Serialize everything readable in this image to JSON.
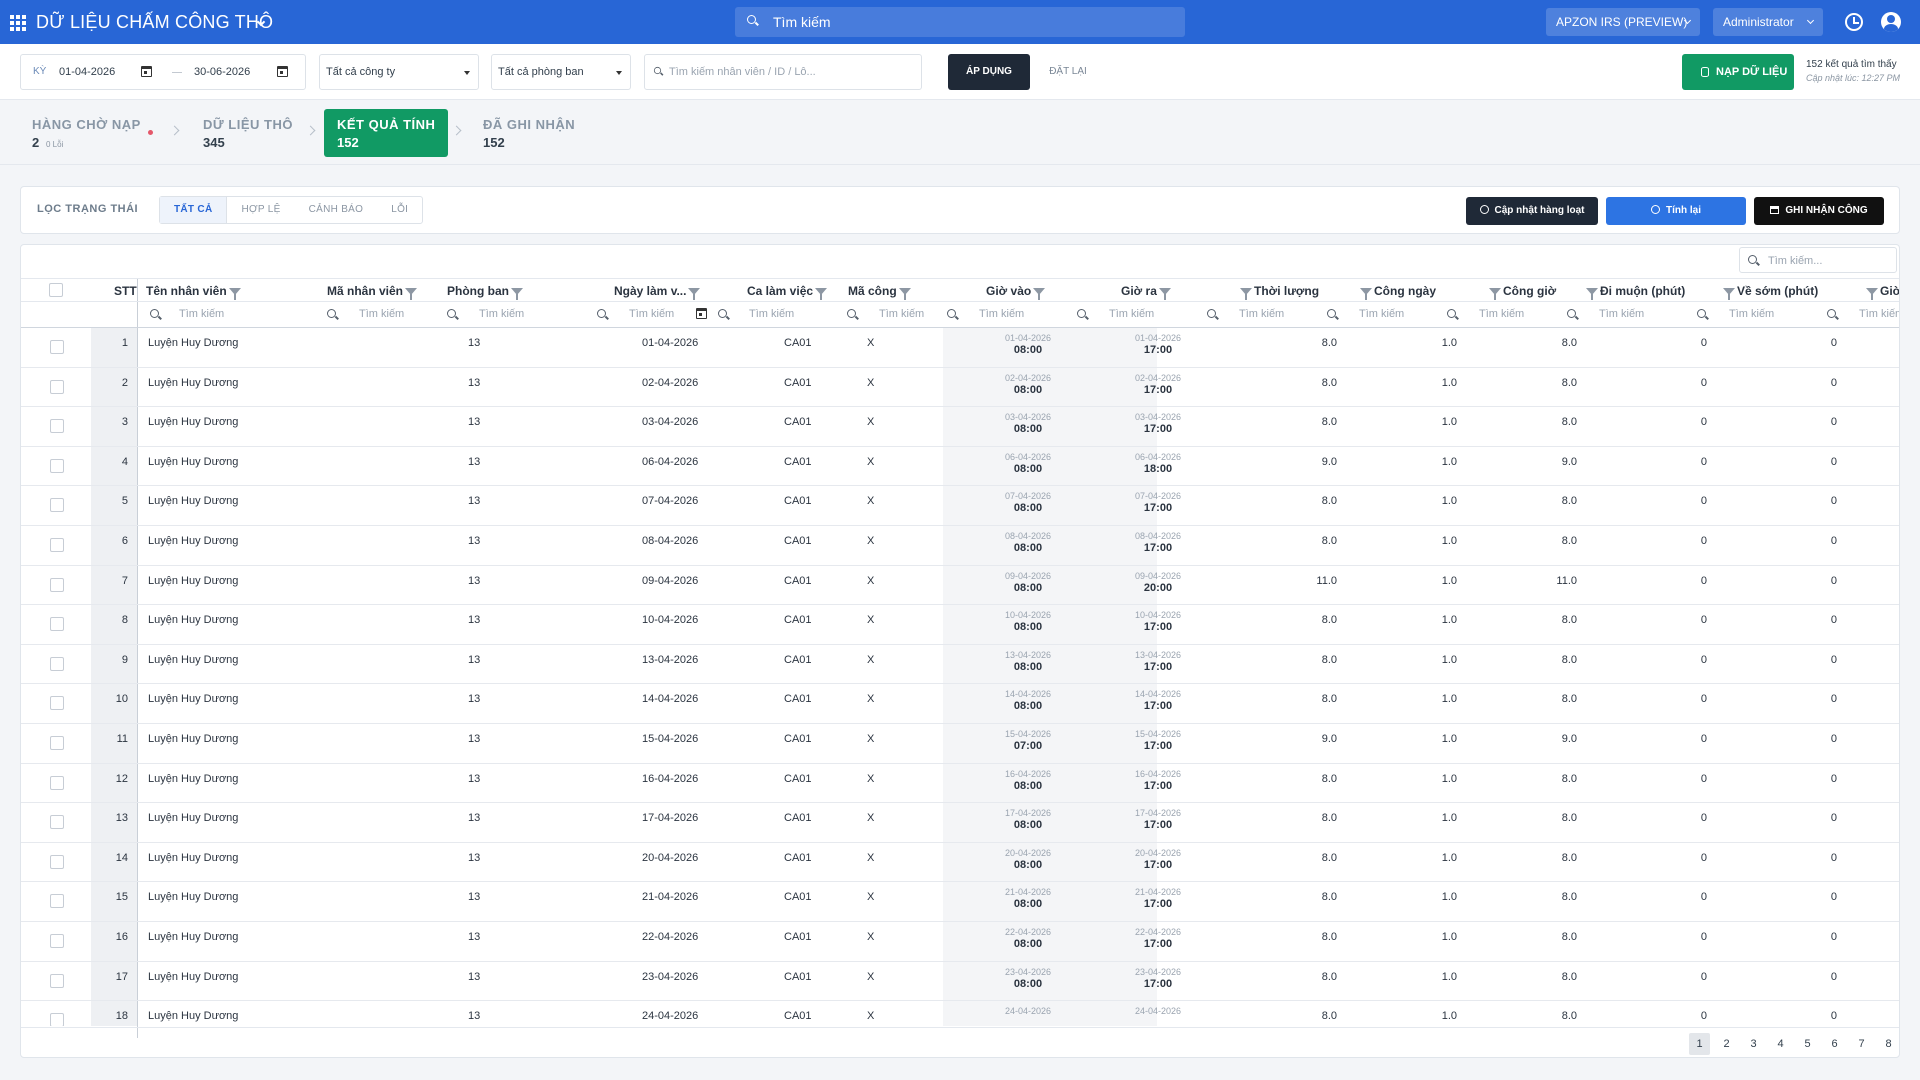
{
  "header": {
    "title": "DỮ LIỆU CHẤM CÔNG THÔ",
    "search_placeholder": "Tìm kiếm",
    "environment": "APZON IRS (PREVIEW)",
    "user": "Administrator"
  },
  "filters": {
    "period_label": "KỲ",
    "date_from": "01-04-2026",
    "date_to": "30-06-2026",
    "company": "Tất cả công ty",
    "department": "Tất cả phòng ban",
    "employee_search_placeholder": "Tìm kiếm nhân viên / ID / Lô...",
    "apply_label": "ÁP DỤNG",
    "reset_label": "ĐẶT LẠI",
    "load_label": "NẠP DỮ LIỆU",
    "result_count": "152 kết quả tìm thấy",
    "updated": "Cập nhật lúc: 12:27 PM"
  },
  "steps": [
    {
      "title": "HÀNG CHỜ NẠP",
      "count": "2",
      "sub": "0 Lỗi"
    },
    {
      "title": "DỮ LIỆU THÔ",
      "count": "345"
    },
    {
      "title": "KẾT QUẢ TÍNH",
      "count": "152"
    },
    {
      "title": "ĐÃ GHI NHẬN",
      "count": "152"
    }
  ],
  "status_filter": {
    "label": "LỌC TRẠNG THÁI",
    "options": [
      "TẤT CẢ",
      "HỢP LỆ",
      "CẢNH BÁO",
      "LỖI"
    ]
  },
  "actions": {
    "bulk_update": "Cập nhật hàng loạt",
    "recalc": "Tính lại",
    "record": "GHI NHẬN CÔNG"
  },
  "table": {
    "search_placeholder": "Tìm kiếm...",
    "filter_placeholder": "Tìm kiếm",
    "columns": [
      "STT",
      "Tên nhân viên",
      "Mã nhân viên",
      "Phòng ban",
      "Ngày làm v...",
      "Ca làm việc",
      "Mã công",
      "Giờ vào",
      "Giờ ra",
      "Thời lượng",
      "Công ngày",
      "Công giờ",
      "Đi muộn (phút)",
      "Về sớm (phút)",
      "Giờ"
    ],
    "rows": [
      {
        "stt": "1",
        "name": "Luyện Huy Dương",
        "dept": "13",
        "date": "01-04-2026",
        "shift": "CA01",
        "code": "X",
        "in_d": "01-04-2026",
        "in_t": "08:00",
        "out_d": "01-04-2026",
        "out_t": "17:00",
        "dur": "8.0",
        "day": "1.0",
        "hour": "8.0",
        "late": "0",
        "early": "0"
      },
      {
        "stt": "2",
        "name": "Luyện Huy Dương",
        "dept": "13",
        "date": "02-04-2026",
        "shift": "CA01",
        "code": "X",
        "in_d": "02-04-2026",
        "in_t": "08:00",
        "out_d": "02-04-2026",
        "out_t": "17:00",
        "dur": "8.0",
        "day": "1.0",
        "hour": "8.0",
        "late": "0",
        "early": "0"
      },
      {
        "stt": "3",
        "name": "Luyện Huy Dương",
        "dept": "13",
        "date": "03-04-2026",
        "shift": "CA01",
        "code": "X",
        "in_d": "03-04-2026",
        "in_t": "08:00",
        "out_d": "03-04-2026",
        "out_t": "17:00",
        "dur": "8.0",
        "day": "1.0",
        "hour": "8.0",
        "late": "0",
        "early": "0"
      },
      {
        "stt": "4",
        "name": "Luyện Huy Dương",
        "dept": "13",
        "date": "06-04-2026",
        "shift": "CA01",
        "code": "X",
        "in_d": "06-04-2026",
        "in_t": "08:00",
        "out_d": "06-04-2026",
        "out_t": "18:00",
        "dur": "9.0",
        "day": "1.0",
        "hour": "9.0",
        "late": "0",
        "early": "0"
      },
      {
        "stt": "5",
        "name": "Luyện Huy Dương",
        "dept": "13",
        "date": "07-04-2026",
        "shift": "CA01",
        "code": "X",
        "in_d": "07-04-2026",
        "in_t": "08:00",
        "out_d": "07-04-2026",
        "out_t": "17:00",
        "dur": "8.0",
        "day": "1.0",
        "hour": "8.0",
        "late": "0",
        "early": "0"
      },
      {
        "stt": "6",
        "name": "Luyện Huy Dương",
        "dept": "13",
        "date": "08-04-2026",
        "shift": "CA01",
        "code": "X",
        "in_d": "08-04-2026",
        "in_t": "08:00",
        "out_d": "08-04-2026",
        "out_t": "17:00",
        "dur": "8.0",
        "day": "1.0",
        "hour": "8.0",
        "late": "0",
        "early": "0"
      },
      {
        "stt": "7",
        "name": "Luyện Huy Dương",
        "dept": "13",
        "date": "09-04-2026",
        "shift": "CA01",
        "code": "X",
        "in_d": "09-04-2026",
        "in_t": "08:00",
        "out_d": "09-04-2026",
        "out_t": "20:00",
        "dur": "11.0",
        "day": "1.0",
        "hour": "11.0",
        "late": "0",
        "early": "0"
      },
      {
        "stt": "8",
        "name": "Luyện Huy Dương",
        "dept": "13",
        "date": "10-04-2026",
        "shift": "CA01",
        "code": "X",
        "in_d": "10-04-2026",
        "in_t": "08:00",
        "out_d": "10-04-2026",
        "out_t": "17:00",
        "dur": "8.0",
        "day": "1.0",
        "hour": "8.0",
        "late": "0",
        "early": "0"
      },
      {
        "stt": "9",
        "name": "Luyện Huy Dương",
        "dept": "13",
        "date": "13-04-2026",
        "shift": "CA01",
        "code": "X",
        "in_d": "13-04-2026",
        "in_t": "08:00",
        "out_d": "13-04-2026",
        "out_t": "17:00",
        "dur": "8.0",
        "day": "1.0",
        "hour": "8.0",
        "late": "0",
        "early": "0"
      },
      {
        "stt": "10",
        "name": "Luyện Huy Dương",
        "dept": "13",
        "date": "14-04-2026",
        "shift": "CA01",
        "code": "X",
        "in_d": "14-04-2026",
        "in_t": "08:00",
        "out_d": "14-04-2026",
        "out_t": "17:00",
        "dur": "8.0",
        "day": "1.0",
        "hour": "8.0",
        "late": "0",
        "early": "0"
      },
      {
        "stt": "11",
        "name": "Luyện Huy Dương",
        "dept": "13",
        "date": "15-04-2026",
        "shift": "CA01",
        "code": "X",
        "in_d": "15-04-2026",
        "in_t": "07:00",
        "out_d": "15-04-2026",
        "out_t": "17:00",
        "dur": "9.0",
        "day": "1.0",
        "hour": "9.0",
        "late": "0",
        "early": "0"
      },
      {
        "stt": "12",
        "name": "Luyện Huy Dương",
        "dept": "13",
        "date": "16-04-2026",
        "shift": "CA01",
        "code": "X",
        "in_d": "16-04-2026",
        "in_t": "08:00",
        "out_d": "16-04-2026",
        "out_t": "17:00",
        "dur": "8.0",
        "day": "1.0",
        "hour": "8.0",
        "late": "0",
        "early": "0"
      },
      {
        "stt": "13",
        "name": "Luyện Huy Dương",
        "dept": "13",
        "date": "17-04-2026",
        "shift": "CA01",
        "code": "X",
        "in_d": "17-04-2026",
        "in_t": "08:00",
        "out_d": "17-04-2026",
        "out_t": "17:00",
        "dur": "8.0",
        "day": "1.0",
        "hour": "8.0",
        "late": "0",
        "early": "0"
      },
      {
        "stt": "14",
        "name": "Luyện Huy Dương",
        "dept": "13",
        "date": "20-04-2026",
        "shift": "CA01",
        "code": "X",
        "in_d": "20-04-2026",
        "in_t": "08:00",
        "out_d": "20-04-2026",
        "out_t": "17:00",
        "dur": "8.0",
        "day": "1.0",
        "hour": "8.0",
        "late": "0",
        "early": "0"
      },
      {
        "stt": "15",
        "name": "Luyện Huy Dương",
        "dept": "13",
        "date": "21-04-2026",
        "shift": "CA01",
        "code": "X",
        "in_d": "21-04-2026",
        "in_t": "08:00",
        "out_d": "21-04-2026",
        "out_t": "17:00",
        "dur": "8.0",
        "day": "1.0",
        "hour": "8.0",
        "late": "0",
        "early": "0"
      },
      {
        "stt": "16",
        "name": "Luyện Huy Dương",
        "dept": "13",
        "date": "22-04-2026",
        "shift": "CA01",
        "code": "X",
        "in_d": "22-04-2026",
        "in_t": "08:00",
        "out_d": "22-04-2026",
        "out_t": "17:00",
        "dur": "8.0",
        "day": "1.0",
        "hour": "8.0",
        "late": "0",
        "early": "0"
      },
      {
        "stt": "17",
        "name": "Luyện Huy Dương",
        "dept": "13",
        "date": "23-04-2026",
        "shift": "CA01",
        "code": "X",
        "in_d": "23-04-2026",
        "in_t": "08:00",
        "out_d": "23-04-2026",
        "out_t": "17:00",
        "dur": "8.0",
        "day": "1.0",
        "hour": "8.0",
        "late": "0",
        "early": "0"
      },
      {
        "stt": "18",
        "name": "Luyện Huy Dương",
        "dept": "13",
        "date": "24-04-2026",
        "shift": "CA01",
        "code": "X",
        "in_d": "24-04-2026",
        "in_t": "",
        "out_d": "24-04-2026",
        "out_t": "",
        "dur": "8.0",
        "day": "1.0",
        "hour": "8.0",
        "late": "0",
        "early": "0"
      }
    ]
  },
  "pagination": {
    "pages": [
      "1",
      "2",
      "3",
      "4",
      "5",
      "6",
      "7",
      "8"
    ],
    "current": "1"
  },
  "colors": {
    "primary": "#2866d6",
    "success": "#119a64",
    "dark": "#1f2937",
    "accent_blue": "#2d74e3"
  }
}
